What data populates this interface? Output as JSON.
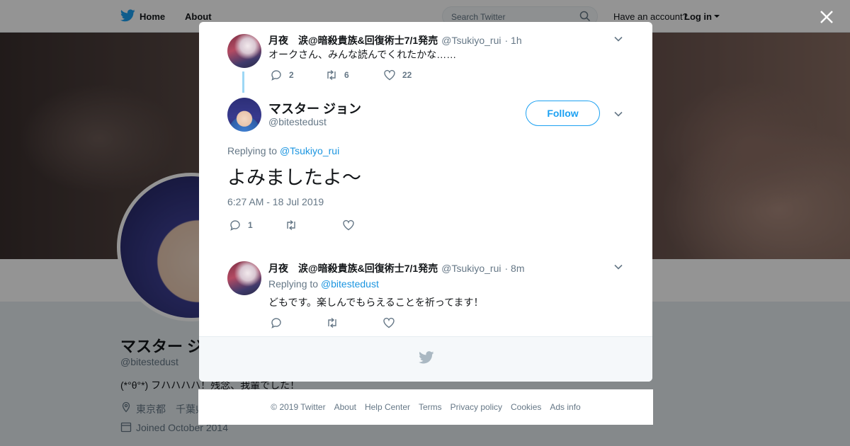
{
  "topbar": {
    "home": "Home",
    "about": "About",
    "search_placeholder": "Search Twitter",
    "have_account": "Have an account?",
    "login": "Log in"
  },
  "profile": {
    "name": "マスター ジ",
    "handle": "@bitestedust",
    "bio": "(*°θ°*) フハハハハ！残念、我輩でした！",
    "location": "東京都　千葉県",
    "joined": "Joined October 2014"
  },
  "parent_tweet": {
    "name": "月夜　涙@暗殺貴族&回復術士7/1発売",
    "handle": "@Tsukiyo_rui",
    "time": "· 1h",
    "text": "オークさん、みんな読んでくれたかな……",
    "replies": "2",
    "retweets": "6",
    "likes": "22"
  },
  "main_tweet": {
    "name": "マスター ジョン",
    "handle": "@bitestedust",
    "follow_label": "Follow",
    "replying_to_label": "Replying to",
    "replying_to_handle": "@Tsukiyo_rui",
    "text": "よみましたよ～",
    "timestamp": "6:27 AM - 18 Jul 2019",
    "replies": "1"
  },
  "reply_tweet": {
    "name": "月夜　涙@暗殺貴族&回復術士7/1発売",
    "handle": "@Tsukiyo_rui",
    "time": "· 8m",
    "replying_to_label": "Replying to",
    "replying_to_handle": "@bitestedust",
    "text": "どもです。楽しんでもらえることを祈ってます！"
  },
  "footer": {
    "copyright": "© 2019 Twitter",
    "about": "About",
    "help": "Help Center",
    "terms": "Terms",
    "privacy": "Privacy policy",
    "cookies": "Cookies",
    "ads": "Ads info"
  },
  "colors": {
    "accent": "#1da1f2",
    "link": "#1b95e0",
    "muted": "#657786",
    "thread_line": "#9dd7f5"
  }
}
